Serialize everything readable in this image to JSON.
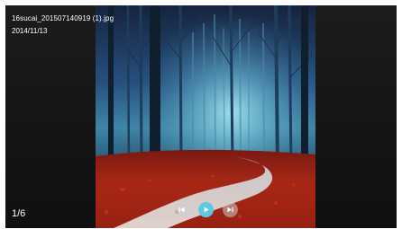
{
  "file": {
    "name": "16sucai_201507140919 (1).jpg",
    "date": "2014/11/13"
  },
  "pager": {
    "counter": "1/6"
  },
  "controls": {
    "prev_icon": "skip-previous-icon",
    "play_icon": "play-icon",
    "next_icon": "skip-next-icon",
    "accent_color": "#5ec9e0"
  },
  "photo": {
    "description_icon": "forest-path-image"
  }
}
